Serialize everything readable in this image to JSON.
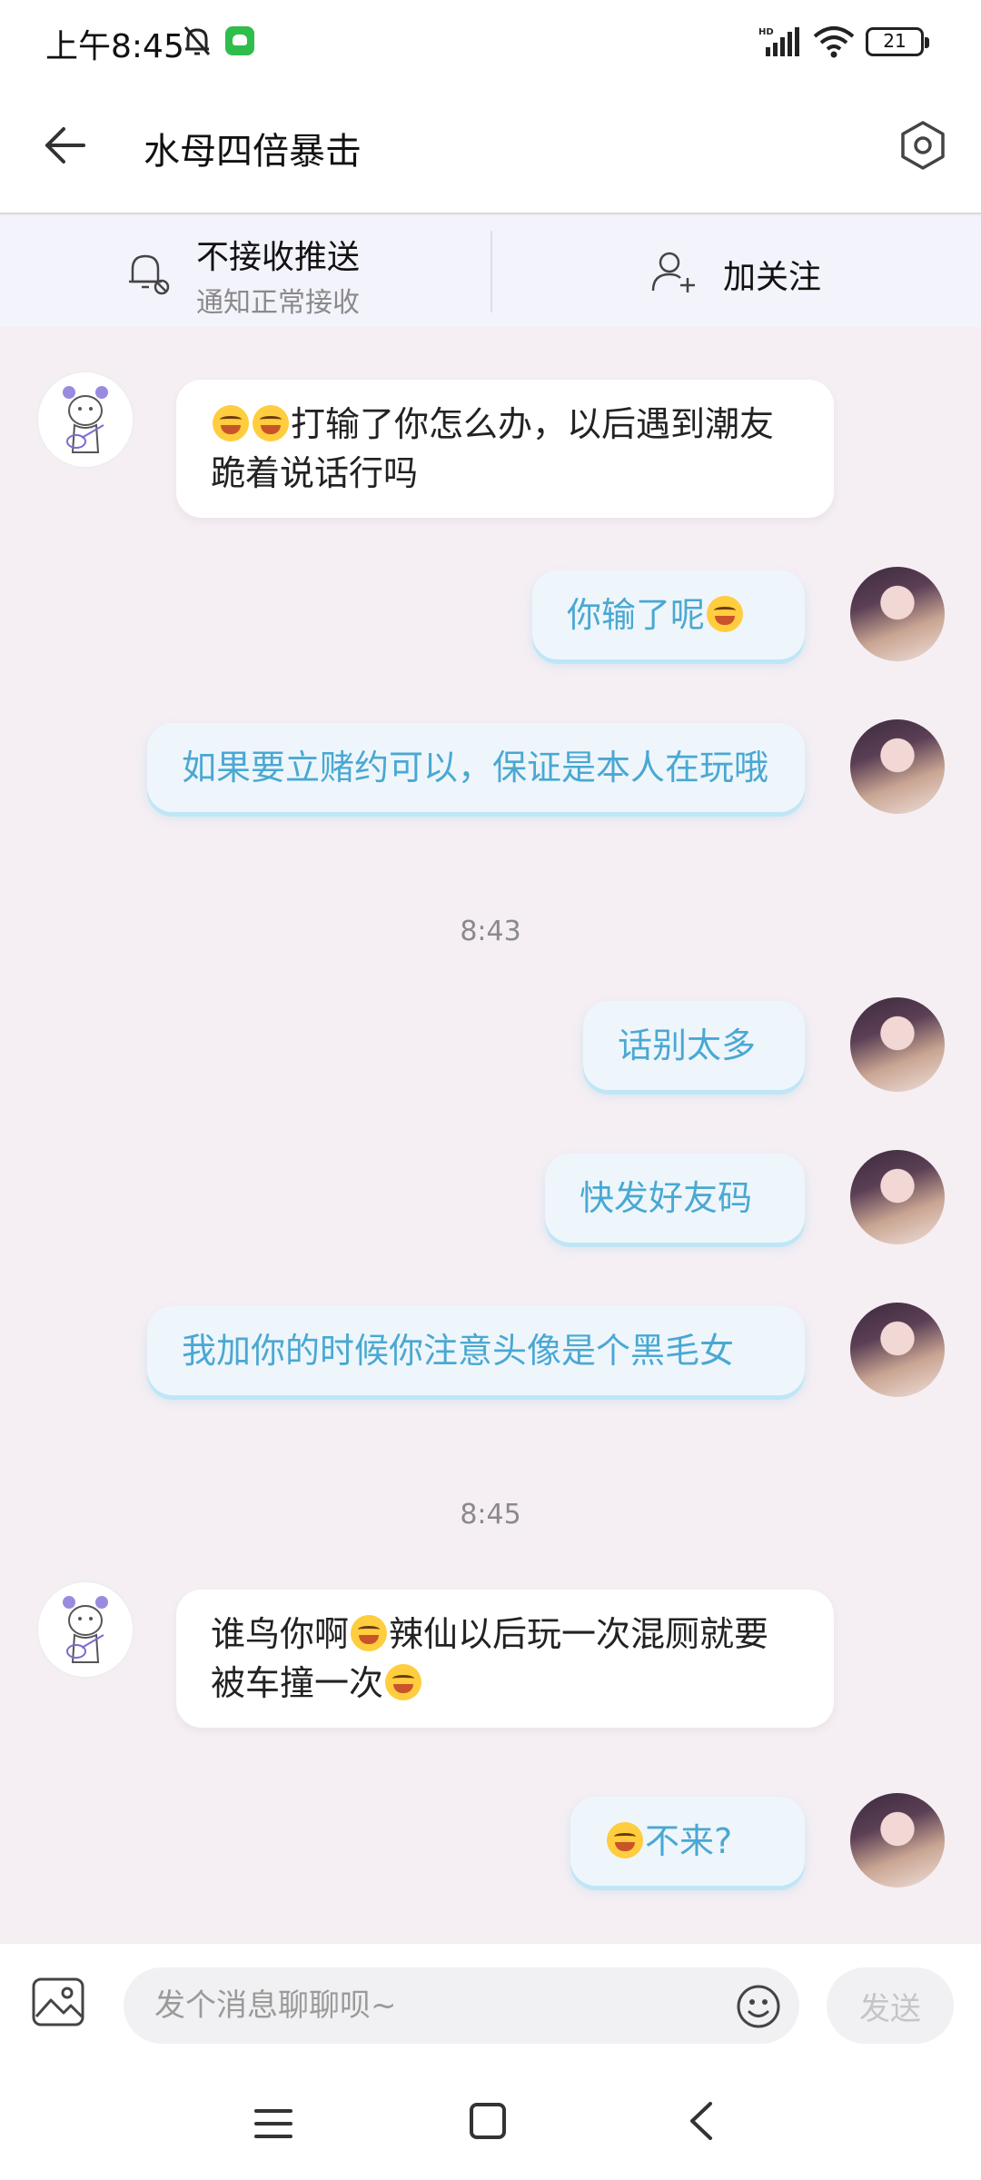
{
  "status_bar": {
    "time": "上午8:45",
    "battery": "21",
    "icons": [
      "bell-off-icon",
      "app-notification-icon",
      "hd-signal-icon",
      "wifi-icon",
      "battery-icon"
    ]
  },
  "header": {
    "title": "水母四倍暴击",
    "back_icon": "arrow-left-icon",
    "settings_icon": "hexagon-settings-icon"
  },
  "notify_bar": {
    "push_title": "不接收推送",
    "push_subtitle": "通知正常接收",
    "follow_label": "加关注"
  },
  "messages": [
    {
      "sender": "peer",
      "text": "打输了你怎么办，以后遇到潮友跪着说话行吗",
      "prefix_emoji": [
        "laugh-cry-emoji",
        "laugh-cry-emoji"
      ]
    },
    {
      "sender": "self",
      "text": "你输了呢",
      "suffix_emoji": [
        "sob-emoji"
      ]
    },
    {
      "sender": "self",
      "text": "如果要立赌约可以，保证是本人在玩哦"
    },
    {
      "sender": "self",
      "text": "话别太多"
    },
    {
      "sender": "self",
      "text": "快发好友码"
    },
    {
      "sender": "self",
      "text": "我加你的时候你注意头像是个黑毛女"
    },
    {
      "sender": "peer",
      "text_a": "谁鸟你啊",
      "text_b": "辣仙以后玩一次混厕就要被车撞一次",
      "emoji": [
        "laugh-cry-emoji",
        "sob-emoji"
      ]
    },
    {
      "sender": "self",
      "text": "不来?",
      "prefix_emoji": [
        "laugh-cry-emoji"
      ]
    }
  ],
  "timestamps": [
    "8:43",
    "8:45"
  ],
  "input_bar": {
    "placeholder": "发个消息聊聊呗~",
    "send_label": "发送"
  },
  "colors": {
    "self_bubble_text": "#4aa8d2",
    "self_bubble_bg": "#eef6fc",
    "chat_bg": "#f5eff4",
    "notify_bar_bg": "#f3f3fc"
  }
}
